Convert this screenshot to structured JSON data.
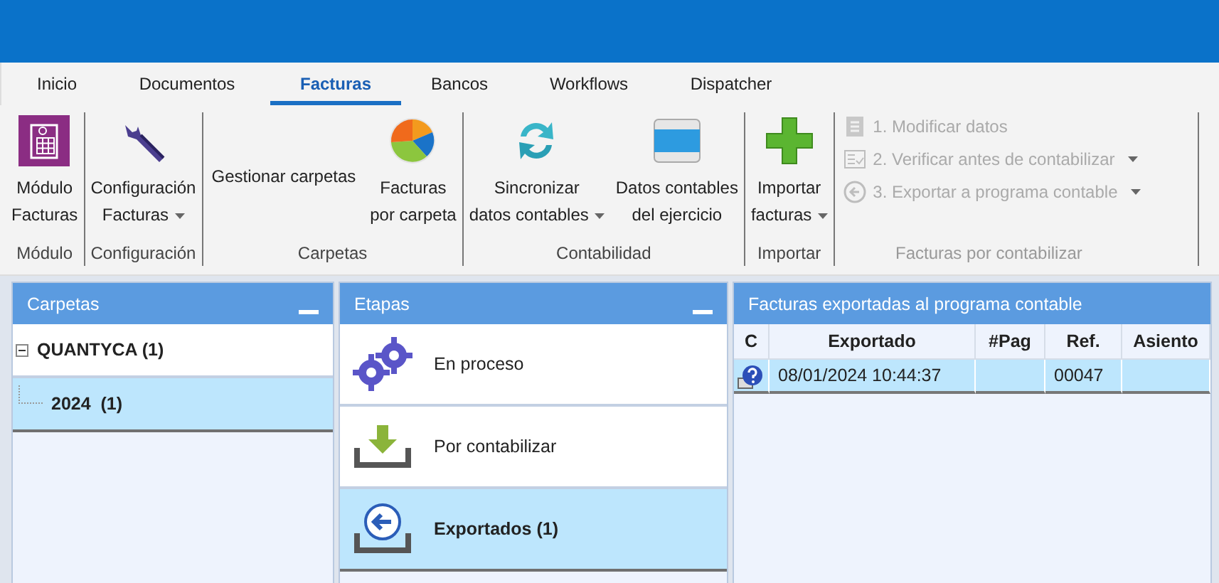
{
  "tabs": [
    {
      "label": "Inicio",
      "selected": false
    },
    {
      "label": "Documentos",
      "selected": false
    },
    {
      "label": "Facturas",
      "selected": true
    },
    {
      "label": "Bancos",
      "selected": false
    },
    {
      "label": "Workflows",
      "selected": false
    },
    {
      "label": "Dispatcher",
      "selected": false
    }
  ],
  "ribbon_groups": [
    {
      "label": "Módulo",
      "items": [
        {
          "kind": "large",
          "lines": [
            "Módulo",
            "Facturas"
          ]
        }
      ]
    },
    {
      "label": "Configuración",
      "items": [
        {
          "kind": "large",
          "lines": [
            "Configuración",
            "Facturas"
          ],
          "dropdown": true
        }
      ]
    },
    {
      "label": "Carpetas",
      "items": [
        {
          "kind": "text",
          "lines": [
            "Gestionar carpetas"
          ]
        },
        {
          "kind": "large",
          "lines": [
            "Facturas",
            "por carpeta"
          ]
        }
      ]
    },
    {
      "label": "Contabilidad",
      "items": [
        {
          "kind": "large",
          "lines": [
            "Sincronizar",
            "datos contables"
          ],
          "dropdown": true
        },
        {
          "kind": "large",
          "lines": [
            "Datos contables",
            "del ejercicio"
          ]
        }
      ]
    },
    {
      "label": "Importar",
      "items": [
        {
          "kind": "large",
          "lines": [
            "Importar",
            "facturas"
          ],
          "dropdown": true
        }
      ]
    },
    {
      "label": "Facturas por contabilizar",
      "disabled": true,
      "items": [
        {
          "kind": "small",
          "lines": [
            "1. Modificar datos"
          ],
          "disabled": true
        },
        {
          "kind": "small",
          "lines": [
            "2. Verificar antes de contabilizar"
          ],
          "dropdown": true,
          "disabled": true
        },
        {
          "kind": "small",
          "lines": [
            "3. Exportar a programa contable"
          ],
          "dropdown": true,
          "disabled": true
        }
      ]
    }
  ],
  "carpetas": {
    "title": "Carpetas",
    "tree": [
      {
        "label": "QUANTYCA (1)",
        "expanded": true,
        "selected": false,
        "children": [
          {
            "label": "2024  (1)",
            "selected": true
          }
        ]
      }
    ]
  },
  "etapas": {
    "title": "Etapas",
    "items": [
      {
        "label": "En proceso",
        "selected": false
      },
      {
        "label": "Por contabilizar",
        "selected": false
      },
      {
        "label": "Exportados (1)",
        "selected": true
      }
    ]
  },
  "facturas": {
    "title": "Facturas exportadas al programa contable",
    "columns": [
      "C",
      "Exportado",
      "#Pag",
      "Ref.",
      "Asiento"
    ],
    "rows": [
      {
        "selected": true,
        "exportado": "08/01/2024 10:44:37",
        "ref": "00047"
      }
    ]
  }
}
